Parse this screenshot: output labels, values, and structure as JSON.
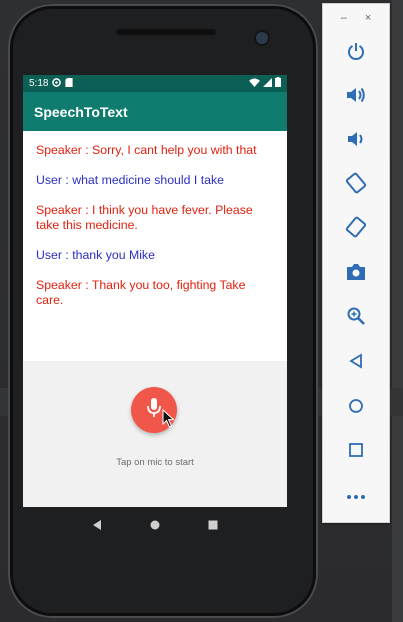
{
  "status_bar": {
    "time": "5:18"
  },
  "app": {
    "title": "SpeechToText"
  },
  "messages": [
    {
      "role": "speaker",
      "text": "Speaker : Sorry, I cant help you with that"
    },
    {
      "role": "user",
      "text": "User : what medicine should I take"
    },
    {
      "role": "speaker",
      "text": "Speaker : I think you have fever. Please take this medicine."
    },
    {
      "role": "user",
      "text": "User : thank you Mike"
    },
    {
      "role": "speaker",
      "text": "Speaker : Thank you too, fighting Take care."
    }
  ],
  "mic": {
    "hint": "Tap on mic to start"
  },
  "emulator_toolbar": {
    "minimize_label": "–",
    "close_label": "×",
    "buttons": [
      "power-icon",
      "volume-up-icon",
      "volume-down-icon",
      "rotate-left-icon",
      "rotate-right-icon",
      "camera-icon",
      "zoom-icon",
      "back-icon",
      "home-icon",
      "overview-icon",
      "more-icon"
    ]
  },
  "colors": {
    "status_bar": "#0b5f55",
    "app_bar": "#0f7c6f",
    "speaker_text": "#e0210f",
    "user_text": "#2b2fc4",
    "mic_button": "#f0574a"
  }
}
